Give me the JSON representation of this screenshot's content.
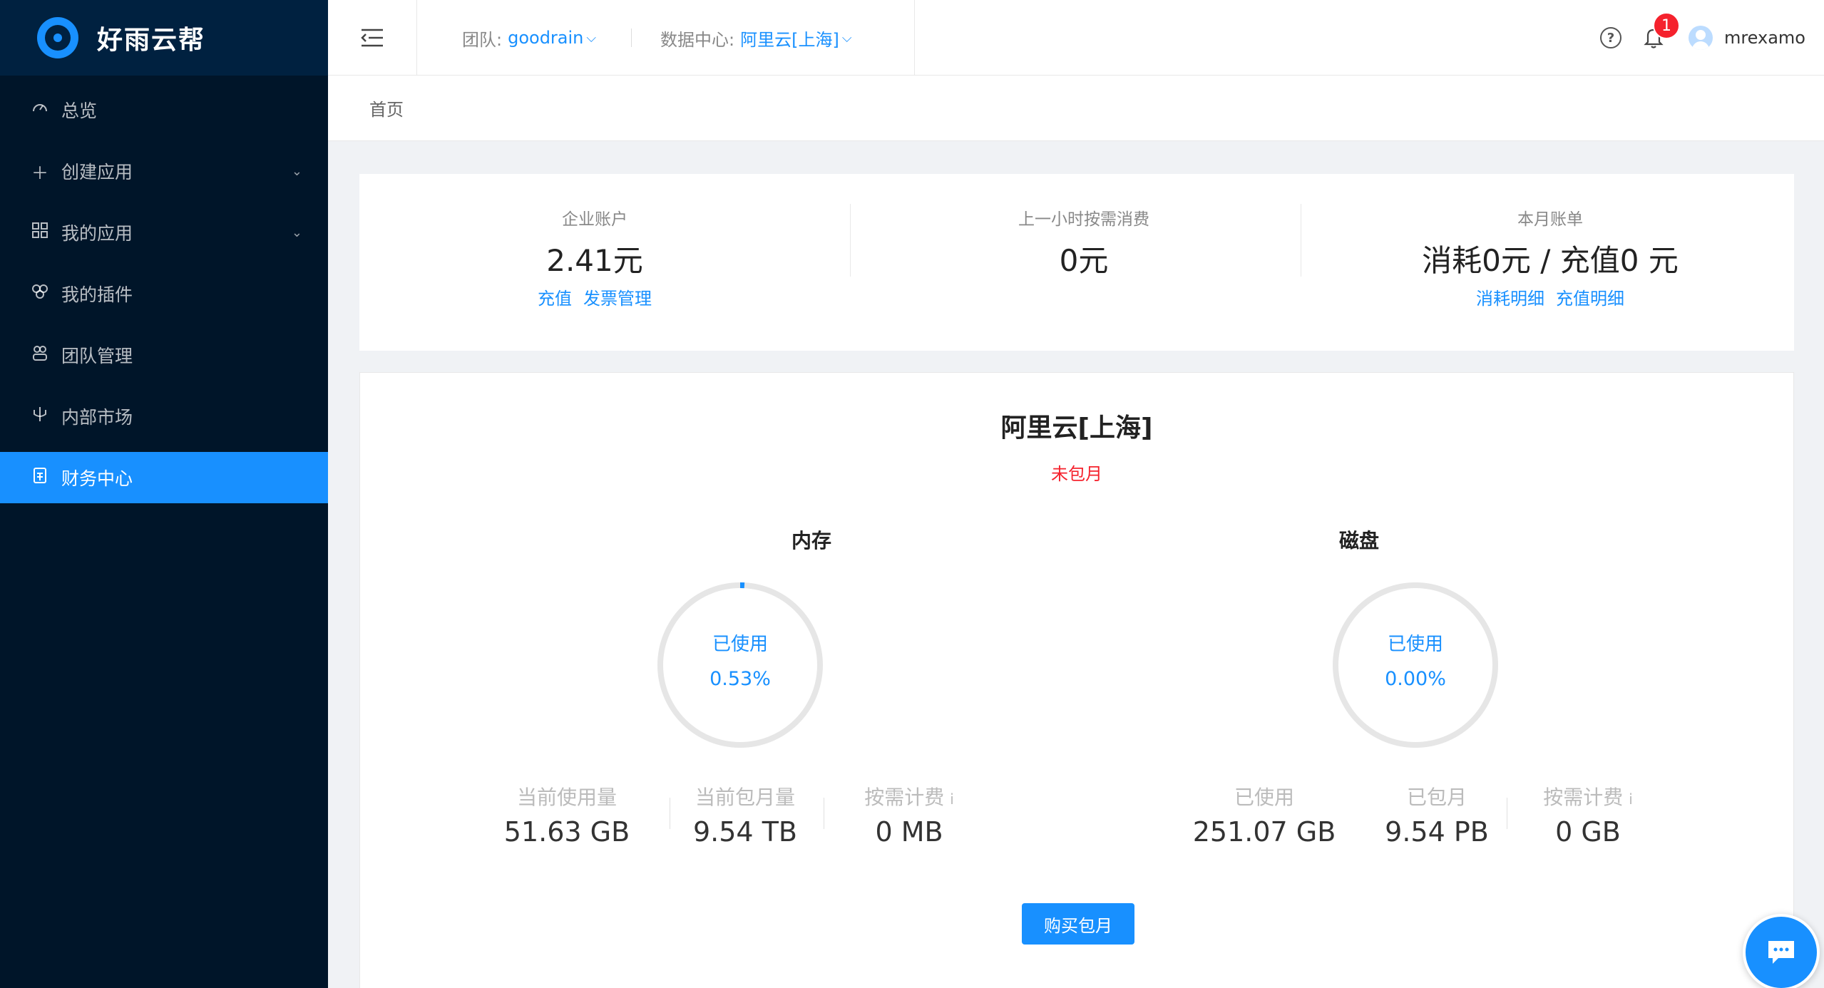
{
  "app": {
    "logo_text": "好雨云帮"
  },
  "sidebar": {
    "items": [
      {
        "label": "总览",
        "icon": "dashboard-icon"
      },
      {
        "label": "创建应用",
        "icon": "plus-icon",
        "expandable": true
      },
      {
        "label": "我的应用",
        "icon": "appstore-icon",
        "expandable": true
      },
      {
        "label": "我的插件",
        "icon": "plugin-icon"
      },
      {
        "label": "团队管理",
        "icon": "team-icon"
      },
      {
        "label": "内部市场",
        "icon": "market-icon"
      },
      {
        "label": "财务中心",
        "icon": "finance-icon",
        "active": true
      }
    ]
  },
  "header": {
    "team_label": "团队:",
    "team_value": "goodrain",
    "dc_label": "数据中心:",
    "dc_value": "阿里云[上海]",
    "notification_count": "1",
    "username": "mrexamo",
    "help_glyph": "?"
  },
  "breadcrumb": {
    "home": "首页"
  },
  "summary": {
    "account": {
      "title": "企业账户",
      "value": "2.41元",
      "link1": "充值",
      "link2": "发票管理"
    },
    "last_hour": {
      "title": "上一小时按需消费",
      "value": "0元"
    },
    "monthly": {
      "title": "本月账单",
      "value": "消耗0元 / 充值0 元",
      "link1": "消耗明细",
      "link2": "充值明细"
    }
  },
  "region": {
    "title": "阿里云[上海]",
    "status": "未包月",
    "memory": {
      "title": "内存",
      "used_label": "已使用",
      "used_percent": "0.53%",
      "used_fraction": 0.0053,
      "stats": [
        {
          "label": "当前使用量",
          "value": "51.63 GB"
        },
        {
          "label": "当前包月量",
          "value": "9.54 TB"
        },
        {
          "label": "按需计费",
          "value": "0 MB",
          "info": "i"
        }
      ]
    },
    "disk": {
      "title": "磁盘",
      "used_label": "已使用",
      "used_percent": "0.00%",
      "used_fraction": 0.0,
      "stats": [
        {
          "label": "已使用",
          "value": "251.07 GB"
        },
        {
          "label": "已包月",
          "value": "9.54 PB"
        },
        {
          "label": "按需计费",
          "value": "0 GB",
          "info": "i"
        }
      ]
    },
    "buy_button": "购买包月"
  },
  "colors": {
    "primary": "#1890ff",
    "sidebar_bg": "#001529",
    "danger": "#f5222d"
  }
}
